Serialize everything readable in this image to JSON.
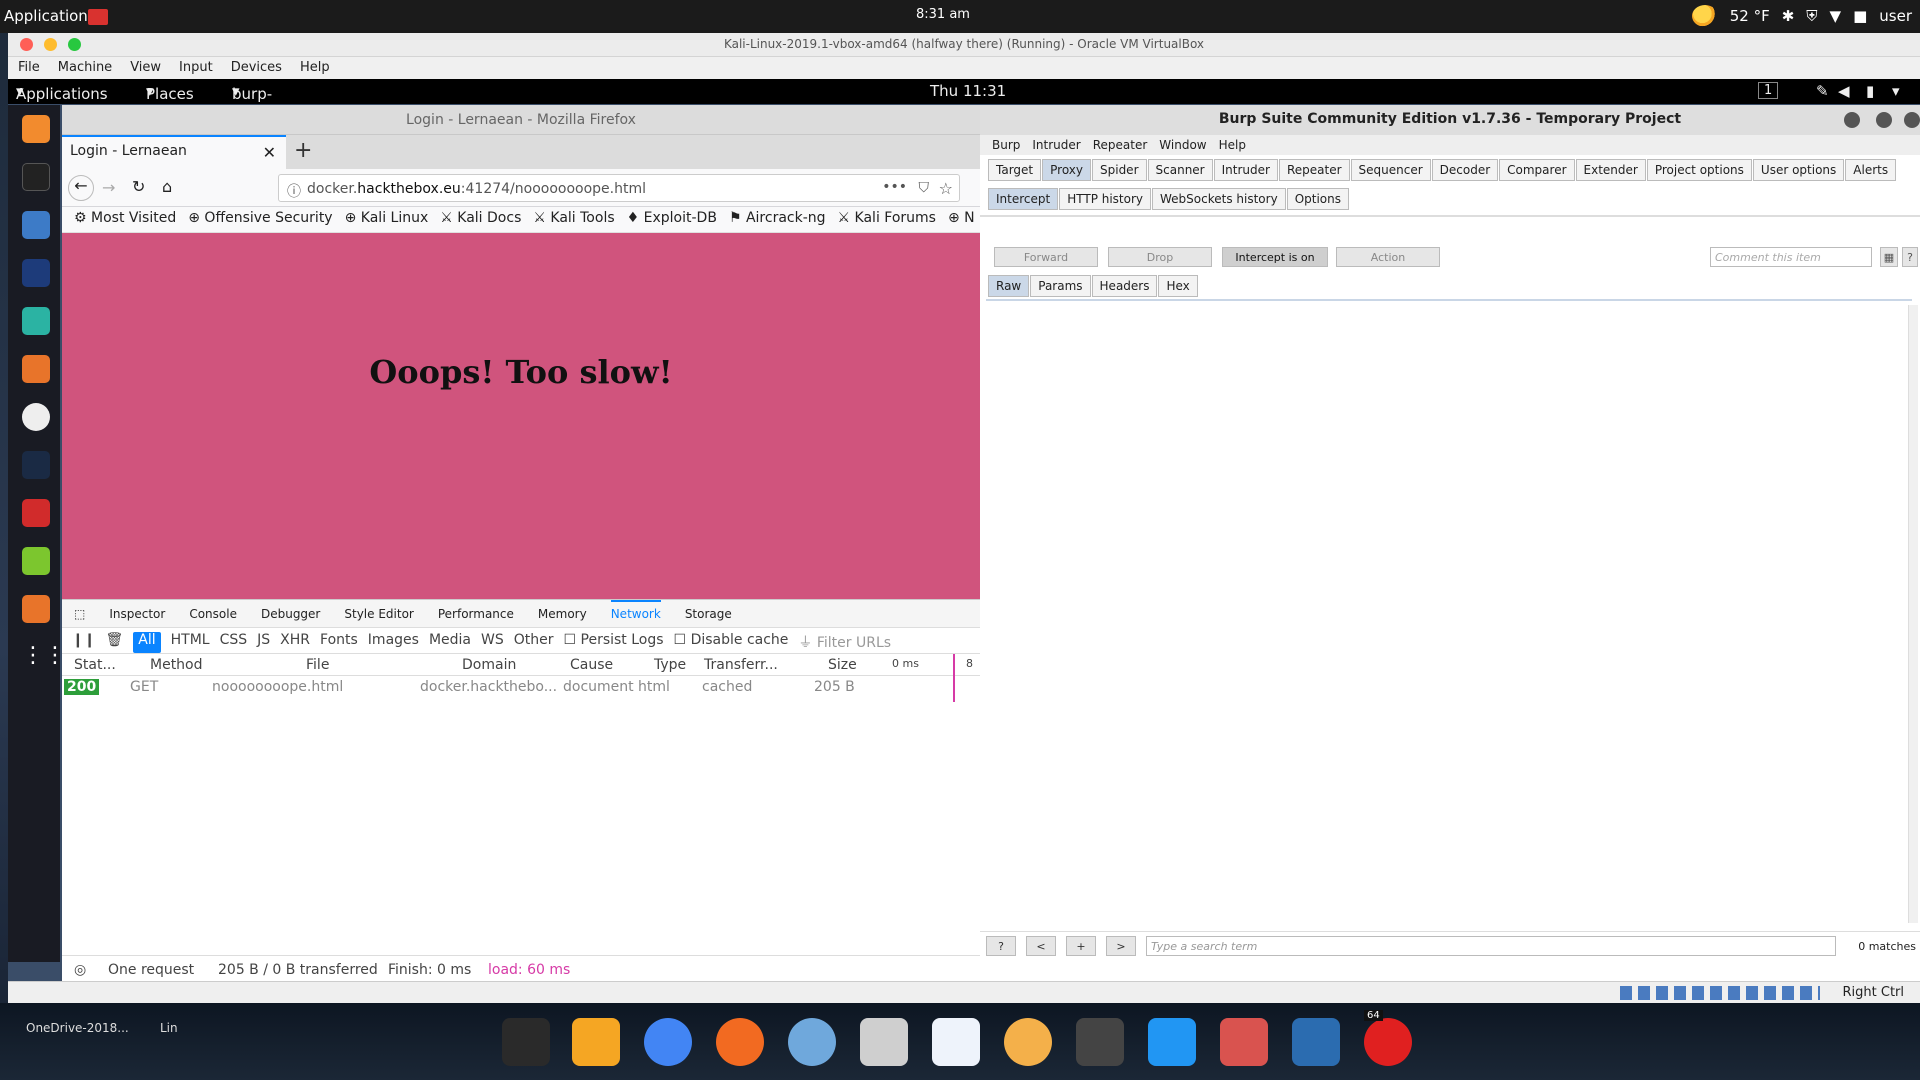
{
  "host": {
    "apps_label": "Applications",
    "clock": "8:31 am",
    "weather": "52 °F",
    "user": "user"
  },
  "vbox": {
    "title": "Kali-Linux-2019.1-vbox-amd64 (halfway there) (Running) - Oracle VM VirtualBox",
    "menu": [
      "File",
      "Machine",
      "View",
      "Input",
      "Devices",
      "Help"
    ],
    "right_ctrl": "Right Ctrl"
  },
  "guest": {
    "apps": "Applications",
    "places": "Places",
    "burp": "burp-StartBurp",
    "clock": "Thu 11:31",
    "workspace": "1"
  },
  "firefox": {
    "window_title": "Login - Lernaean - Mozilla Firefox",
    "tab_title": "Login - Lernaean",
    "url_prefix": "docker.",
    "url_host": "hackthebox.eu",
    "url_rest": ":41274/noooooooope.html",
    "bookmarks": [
      "Most Visited",
      "Offensive Security",
      "Kali Linux",
      "Kali Docs",
      "Kali Tools",
      "Exploit-DB",
      "Aircrack-ng",
      "Kali Forums",
      "N"
    ],
    "page_heading": "Ooops! Too slow!",
    "devtools": {
      "tabs": [
        "Inspector",
        "Console",
        "Debugger",
        "Style Editor",
        "Performance",
        "Memory",
        "Network",
        "Storage"
      ],
      "filters": [
        "All",
        "HTML",
        "CSS",
        "JS",
        "XHR",
        "Fonts",
        "Images",
        "Media",
        "WS",
        "Other"
      ],
      "persist": "Persist Logs",
      "disable_cache": "Disable cache",
      "filter_ph": "Filter URLs",
      "columns": [
        "Stat...",
        "Method",
        "File",
        "Domain",
        "Cause",
        "Type",
        "Transferr...",
        "Size",
        "0 ms",
        "8"
      ],
      "row": {
        "status": "200",
        "method": "GET",
        "file": "noooooooope.html",
        "domain": "docker.hackthebo...",
        "cause": "document",
        "type": "html",
        "transferred": "cached",
        "size": "205 B"
      },
      "status_bar": {
        "requests": "One request",
        "transferred": "205 B / 0 B transferred",
        "finish": "Finish: 0 ms",
        "load": "load: 60 ms"
      }
    }
  },
  "burp": {
    "title": "Burp Suite Community Edition v1.7.36 - Temporary Project",
    "menu": [
      "Burp",
      "Intruder",
      "Repeater",
      "Window",
      "Help"
    ],
    "tabs": [
      "Target",
      "Proxy",
      "Spider",
      "Scanner",
      "Intruder",
      "Repeater",
      "Sequencer",
      "Decoder",
      "Comparer",
      "Extender",
      "Project options",
      "User options",
      "Alerts"
    ],
    "subtabs": [
      "Intercept",
      "HTTP history",
      "WebSockets history",
      "Options"
    ],
    "buttons": {
      "forward": "Forward",
      "drop": "Drop",
      "intercept": "Intercept is on",
      "action": "Action"
    },
    "comment_ph": "Comment this item",
    "viewtabs": [
      "Raw",
      "Params",
      "Headers",
      "Hex"
    ],
    "search_ph": "Type a search term",
    "matches": "0 matches",
    "nav_buttons": [
      "?",
      "<",
      "+",
      ">"
    ]
  },
  "taskbar": {
    "onedrive": "OneDrive-2018...",
    "lin": "Lin",
    "badge": "64"
  }
}
